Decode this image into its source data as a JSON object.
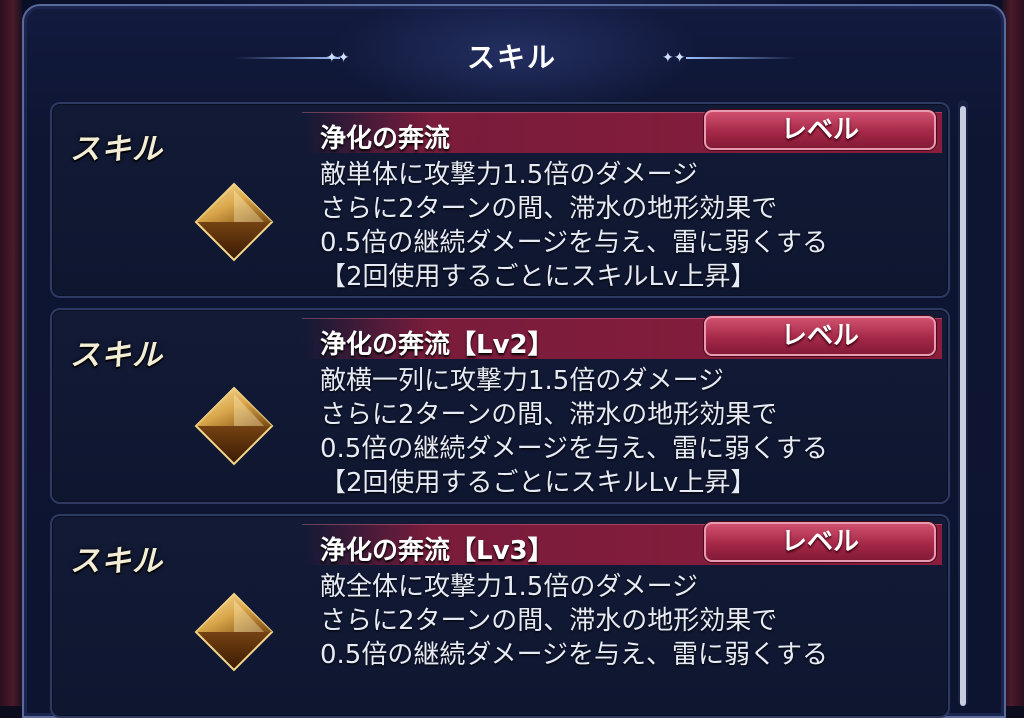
{
  "header": {
    "title": "スキル"
  },
  "colors": {
    "accent_red": "#a62848",
    "panel_navy": "#0e1532",
    "gem_gold": "#d9a64a"
  },
  "skills": [
    {
      "label": "スキル",
      "icon": "gold-gem-icon",
      "name": "浄化の奔流",
      "level_button": "レベル",
      "lines": [
        "敵単体に攻撃力1.5倍のダメージ",
        "さらに2ターンの間、滞水の地形効果で",
        "0.5倍の継続ダメージを与え、雷に弱くする",
        "【2回使用するごとにスキルLv上昇】"
      ]
    },
    {
      "label": "スキル",
      "icon": "gold-gem-icon",
      "name": "浄化の奔流【Lv2】",
      "level_button": "レベル",
      "lines": [
        "敵横一列に攻撃力1.5倍のダメージ",
        "さらに2ターンの間、滞水の地形効果で",
        "0.5倍の継続ダメージを与え、雷に弱くする",
        "【2回使用するごとにスキルLv上昇】"
      ]
    },
    {
      "label": "スキル",
      "icon": "gold-gem-icon",
      "name": "浄化の奔流【Lv3】",
      "level_button": "レベル",
      "lines": [
        "敵全体に攻撃力1.5倍のダメージ",
        "さらに2ターンの間、滞水の地形効果で",
        "0.5倍の継続ダメージを与え、雷に弱くする"
      ]
    }
  ]
}
